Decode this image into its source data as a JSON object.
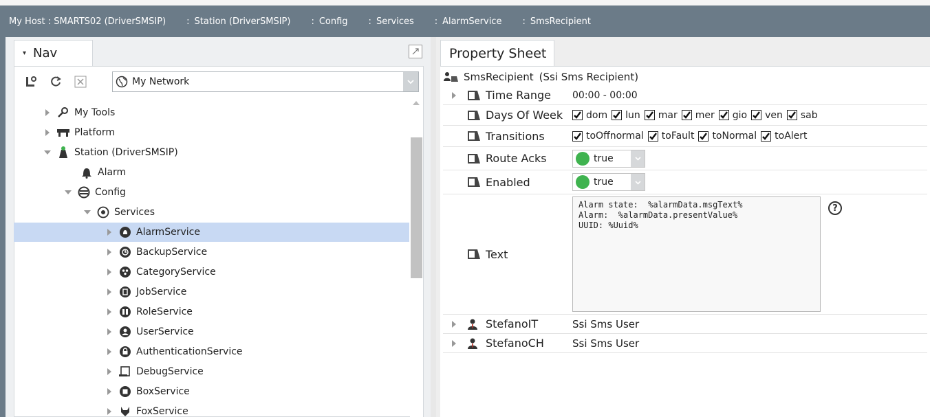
{
  "locator": {
    "items": [
      {
        "label": "My Host : SMARTS02 (DriverSMSIP)"
      },
      {
        "label": "Station (DriverSMSIP)"
      },
      {
        "label": "Config"
      },
      {
        "label": "Services"
      },
      {
        "label": "AlarmService"
      },
      {
        "label": "SmsRecipient"
      }
    ],
    "separator": ":"
  },
  "nav": {
    "tab_label": "Nav",
    "network_select": "My Network",
    "tree": [
      {
        "label": "My Tools"
      },
      {
        "label": "Platform"
      },
      {
        "label": "Station (DriverSMSIP)"
      },
      {
        "label": "Alarm"
      },
      {
        "label": "Config"
      },
      {
        "label": "Services"
      },
      {
        "label": "AlarmService"
      },
      {
        "label": "BackupService"
      },
      {
        "label": "CategoryService"
      },
      {
        "label": "JobService"
      },
      {
        "label": "RoleService"
      },
      {
        "label": "UserService"
      },
      {
        "label": "AuthenticationService"
      },
      {
        "label": "DebugService"
      },
      {
        "label": "BoxService"
      },
      {
        "label": "FoxService"
      }
    ]
  },
  "property_sheet": {
    "tab_label": "Property Sheet",
    "header": {
      "name": "SmsRecipient",
      "type": "(Ssi Sms Recipient)"
    },
    "time_range": {
      "label": "Time Range",
      "value": "00:00 - 00:00"
    },
    "days_of_week": {
      "label": "Days Of Week",
      "days": [
        {
          "label": "dom",
          "checked": true
        },
        {
          "label": "lun",
          "checked": true
        },
        {
          "label": "mar",
          "checked": true
        },
        {
          "label": "mer",
          "checked": true
        },
        {
          "label": "gio",
          "checked": true
        },
        {
          "label": "ven",
          "checked": true
        },
        {
          "label": "sab",
          "checked": true
        }
      ]
    },
    "transitions": {
      "label": "Transitions",
      "items": [
        {
          "label": "toOffnormal",
          "checked": true
        },
        {
          "label": "toFault",
          "checked": true
        },
        {
          "label": "toNormal",
          "checked": true
        },
        {
          "label": "toAlert",
          "checked": true
        }
      ]
    },
    "route_acks": {
      "label": "Route Acks",
      "value": "true",
      "status_color": "#3fb34f"
    },
    "enabled": {
      "label": "Enabled",
      "value": "true",
      "status_color": "#3fb34f"
    },
    "text": {
      "label": "Text",
      "value": "Alarm state:  %alarmData.msgText%\nAlarm:  %alarmData.presentValue%\nUUID: %Uuid%"
    },
    "users": [
      {
        "name": "StefanoIT",
        "type": "Ssi Sms User"
      },
      {
        "name": "StefanoCH",
        "type": "Ssi Sms User"
      }
    ]
  },
  "colors": {
    "locator_bg": "#6b7b88",
    "selection_bg": "#c8d9f3",
    "true_dot": "#3fb34f"
  }
}
